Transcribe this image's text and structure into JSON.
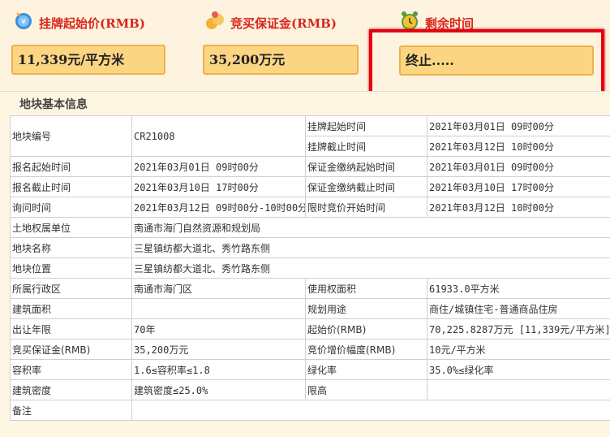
{
  "cards": [
    {
      "label": "挂牌起始价(RMB)",
      "value": "11,339元/平方米",
      "icon": "money-bag-icon"
    },
    {
      "label": "竞买保证金(RMB)",
      "value": "35,200万元",
      "icon": "coins-icon"
    },
    {
      "label": "剩余时间",
      "value": "终止.....",
      "icon": "alarm-clock-icon"
    }
  ],
  "section_title": "地块基本信息",
  "rows": {
    "land_no": {
      "label": "地块编号",
      "value": "CR21008"
    },
    "list_start": {
      "label": "挂牌起始时间",
      "value": "2021年03月01日 09时00分"
    },
    "list_end": {
      "label": "挂牌截止时间",
      "value": "2021年03月12日 10时00分"
    },
    "reg_start": {
      "label": "报名起始时间",
      "value": "2021年03月01日 09时00分"
    },
    "deposit_start": {
      "label": "保证金缴纳起始时间",
      "value": "2021年03月01日 09时00分"
    },
    "reg_end": {
      "label": "报名截止时间",
      "value": "2021年03月10日 17时00分"
    },
    "deposit_end": {
      "label": "保证金缴纳截止时间",
      "value": "2021年03月10日 17时00分"
    },
    "inquiry": {
      "label": "询问时间",
      "value": "2021年03月12日 09时00分-10时00分"
    },
    "timed_bid": {
      "label": "限时竞价开始时间",
      "value": "2021年03月12日 10时00分"
    },
    "owner": {
      "label": "土地权属单位",
      "value": "南通市海门自然资源和规划局"
    },
    "name": {
      "label": "地块名称",
      "value": "三星镇纺都大道北、秀竹路东侧"
    },
    "location": {
      "label": "地块位置",
      "value": "三星镇纺都大道北、秀竹路东侧"
    },
    "district": {
      "label": "所属行政区",
      "value": "南通市海门区"
    },
    "area": {
      "label": "使用权面积",
      "value": "61933.0平方米"
    },
    "build_area": {
      "label": "建筑面积",
      "value": ""
    },
    "usage": {
      "label": "规划用途",
      "value": "商住/城镇住宅-普通商品住房"
    },
    "term": {
      "label": "出让年限",
      "value": "70年"
    },
    "start_price": {
      "label": "起始价(RMB)",
      "value": "70,225.8287万元 [11,339元/平方米]"
    },
    "deposit": {
      "label": "竞买保证金(RMB)",
      "value": "35,200万元"
    },
    "increment": {
      "label": "竞价增价幅度(RMB)",
      "value": "10元/平方米"
    },
    "far": {
      "label": "容积率",
      "value": "1.6≤容积率≤1.8"
    },
    "greening": {
      "label": "绿化率",
      "value": "35.0%≤绿化率"
    },
    "density": {
      "label": "建筑密度",
      "value": "建筑密度≤25.0%"
    },
    "height": {
      "label": "限高",
      "value": ""
    },
    "remark": {
      "label": "备注",
      "value": ""
    }
  },
  "colors": {
    "accent_red": "#d9261c",
    "box_fill": "#fcd582",
    "frame_red": "#e60012"
  }
}
